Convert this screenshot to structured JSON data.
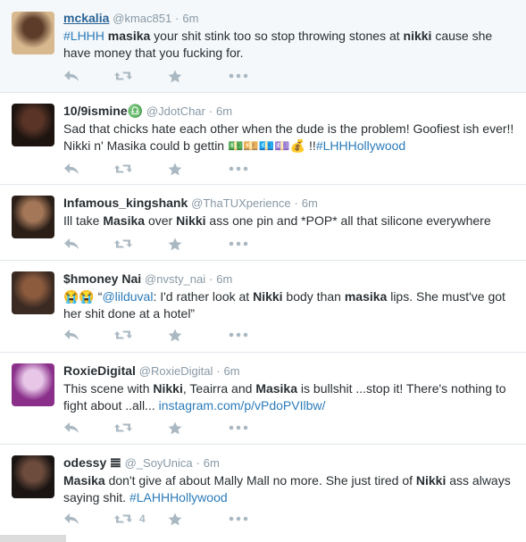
{
  "tweets": [
    {
      "fullname": "mckalia",
      "username": "@kmac851",
      "time": "6m",
      "parts": [
        {
          "t": "#LHHH",
          "k": "tag"
        },
        {
          "t": " "
        },
        {
          "t": "masika",
          "k": "b"
        },
        {
          "t": " your shit stink too so stop throwing stones at "
        },
        {
          "t": "nikki",
          "k": "b"
        },
        {
          "t": " cause she have money that you fucking for."
        }
      ],
      "retweets": "",
      "avatar_colors": [
        "#d8b98f",
        "#5e3c2a"
      ]
    },
    {
      "fullname": "10/9ismine♎",
      "username": "@JdotChar",
      "time": "6m",
      "parts": [
        {
          "t": "Sad that chicks hate each other when the dude is the problem! Goofiest ish ever!! Nikki n' Masika could b gettin "
        },
        {
          "t": "💵💴💶💷💰",
          "k": "emoji"
        },
        {
          "t": " !!"
        },
        {
          "t": "#LHHHollywood",
          "k": "tag"
        }
      ],
      "retweets": "",
      "avatar_colors": [
        "#1d1410",
        "#5a3527"
      ]
    },
    {
      "fullname": "Infamous_kingshank",
      "username": "@ThaTUXperience",
      "time": "6m",
      "parts": [
        {
          "t": "Ill take "
        },
        {
          "t": "Masika",
          "k": "b"
        },
        {
          "t": " over "
        },
        {
          "t": "Nikki",
          "k": "b"
        },
        {
          "t": " ass one pin and *POP* all that silicone everywhere"
        }
      ],
      "retweets": "",
      "avatar_colors": [
        "#2a1e17",
        "#a47758"
      ]
    },
    {
      "fullname": "$hmoney Nai",
      "username": "@nvsty_nai",
      "time": "6m",
      "parts": [
        {
          "t": "😭😭",
          "k": "emoji"
        },
        {
          "t": " “"
        },
        {
          "t": "@lilduval",
          "k": "tag"
        },
        {
          "t": ": I'd rather look at "
        },
        {
          "t": "Nikki",
          "k": "b"
        },
        {
          "t": " body than "
        },
        {
          "t": "masika",
          "k": "b"
        },
        {
          "t": " lips. She must've got her shit done at a hotel”"
        }
      ],
      "retweets": "",
      "avatar_colors": [
        "#3a2a22",
        "#8c5b3e"
      ]
    },
    {
      "fullname": "RoxieDigital",
      "username": "@RoxieDigital",
      "time": "6m",
      "parts": [
        {
          "t": "This scene with "
        },
        {
          "t": "Nikki",
          "k": "b"
        },
        {
          "t": ", Teairra and "
        },
        {
          "t": "Masika",
          "k": "b"
        },
        {
          "t": " is bullshit ...stop it! There's nothing to fight about ..all... "
        },
        {
          "t": "instagram.com/p/vPdoPVIlbw/",
          "k": "tag"
        }
      ],
      "retweets": "",
      "avatar_colors": [
        "#8a2f8a",
        "#e7c6e7"
      ]
    },
    {
      "fullname": "odessy 𝌆",
      "username": "@_SoyUnica",
      "time": "6m",
      "parts": [
        {
          "t": "Masika",
          "k": "b"
        },
        {
          "t": " don't give af about Mally Mall no more. She just tired of "
        },
        {
          "t": "Nikki",
          "k": "b"
        },
        {
          "t": " ass always saying shit. "
        },
        {
          "t": "#LAHHHollywood",
          "k": "tag"
        }
      ],
      "retweets": "4",
      "avatar_colors": [
        "#1a1412",
        "#6d4c3d"
      ]
    }
  ],
  "icons": {
    "reply": "reply-icon",
    "retweet": "retweet-icon",
    "favorite": "star-icon",
    "more": "more-icon"
  },
  "colors": {
    "link": "#2b7bb9",
    "muted": "#8899a6",
    "icon": "#aab8c2",
    "highlight_bg": "#f5f8fa"
  }
}
